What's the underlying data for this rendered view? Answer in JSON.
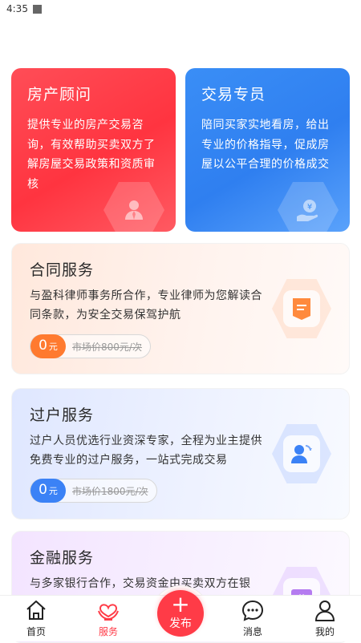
{
  "status_bar": {
    "time": "4:35"
  },
  "top_cards": [
    {
      "title": "房产顾问",
      "desc": "提供专业的房产交易咨询，有效帮助买卖双方了解房屋交易政策和资质审核",
      "icon": "agent-person-icon"
    },
    {
      "title": "交易专员",
      "desc": "陪同买家实地看房，给出专业的价格指导，促成房屋以公平合理的价格成交",
      "icon": "yen-hand-icon"
    }
  ],
  "services": [
    {
      "title": "合同服务",
      "desc": "与盈科律师事务所合作，专业律师为您解读合同条款，为安全交易保驾护航",
      "price": "0",
      "unit": "元",
      "market_price": "市场价800元/次",
      "icon": "document-icon",
      "accent": "#ff7a2f"
    },
    {
      "title": "过户服务",
      "desc": "过户人员优选行业资深专家，全程为业主提供免费专业的过户服务，一站式完成交易",
      "price": "0",
      "unit": "元",
      "market_price": "市场价1800元/次",
      "icon": "person-transfer-icon",
      "accent": "#3b82f6"
    },
    {
      "title": "金融服务",
      "desc": "与多家银行合作，交易资金由买卖双方在银",
      "icon": "wallet-icon"
    }
  ],
  "tab_bar": {
    "items": [
      {
        "label": "首页",
        "icon": "home-icon"
      },
      {
        "label": "服务",
        "icon": "heart-service-icon",
        "active": true
      },
      {
        "label": "发布",
        "icon": "plus-icon"
      },
      {
        "label": "消息",
        "icon": "message-icon"
      },
      {
        "label": "我的",
        "icon": "person-icon"
      }
    ],
    "publish_symbol": "+"
  },
  "colors": {
    "red": "#ff3b47",
    "blue": "#2f7ff0",
    "orange": "#ff7a2f"
  }
}
